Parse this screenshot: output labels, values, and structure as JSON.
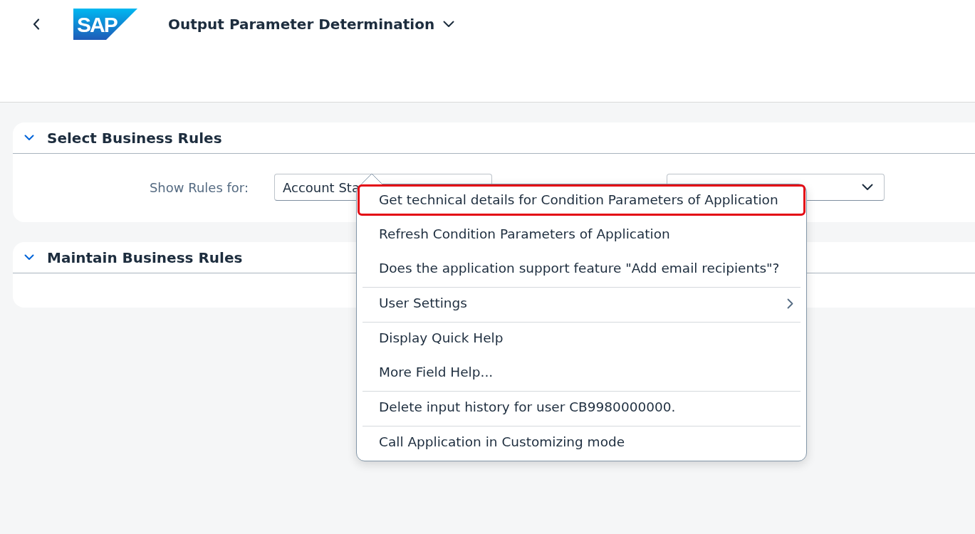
{
  "header": {
    "logo": "SAP",
    "title": "Output Parameter Determination"
  },
  "panels": [
    {
      "title": "Select Business Rules",
      "expanded": true,
      "fields": [
        {
          "kind": "input",
          "label": "Show Rules for:",
          "value": "Account Sta"
        },
        {
          "kind": "dropdown"
        }
      ]
    },
    {
      "title": "Maintain Business Rules",
      "expanded": true
    }
  ],
  "context_menu": {
    "groups": [
      {
        "items": [
          {
            "label": "Get technical details for Condition Parameters of Application",
            "selected": true,
            "submenu": false
          },
          {
            "label": "Refresh Condition Parameters of Application",
            "selected": false,
            "submenu": false
          },
          {
            "label": "Does the application support feature \"Add email recipients\"?",
            "selected": false,
            "submenu": false
          }
        ]
      },
      {
        "items": [
          {
            "label": "User Settings",
            "selected": false,
            "submenu": true
          }
        ]
      },
      {
        "items": [
          {
            "label": "Display Quick Help",
            "selected": false,
            "submenu": false
          },
          {
            "label": "More Field Help...",
            "selected": false,
            "submenu": false
          }
        ]
      },
      {
        "items": [
          {
            "label": "Delete input history for user CB9980000000.",
            "selected": false,
            "submenu": false
          }
        ]
      },
      {
        "items": [
          {
            "label": "Call Application in Customizing mode",
            "selected": false,
            "submenu": false
          }
        ]
      }
    ]
  }
}
